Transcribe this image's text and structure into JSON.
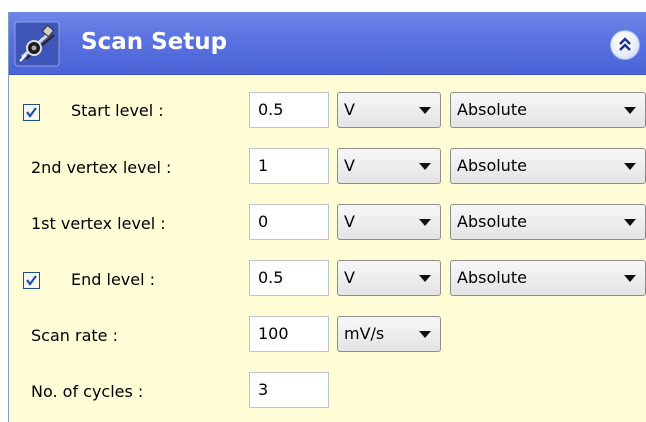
{
  "header": {
    "title": "Scan Setup",
    "icon": "scan-setup-icon",
    "collapse_icon": "double-chevron-up-icon",
    "accent": "#5a72e0"
  },
  "rows": [
    {
      "label": "Start level :",
      "has_checkbox": true,
      "checked": true,
      "value": "0.5",
      "unit": "V",
      "mode": "Absolute"
    },
    {
      "label": "2nd vertex level :",
      "has_checkbox": false,
      "value": "1",
      "unit": "V",
      "mode": "Absolute"
    },
    {
      "label": "1st vertex level :",
      "has_checkbox": false,
      "value": "0",
      "unit": "V",
      "mode": "Absolute"
    },
    {
      "label": "End level :",
      "has_checkbox": true,
      "checked": true,
      "value": "0.5",
      "unit": "V",
      "mode": "Absolute"
    },
    {
      "label": "Scan rate :",
      "has_checkbox": false,
      "value": "100",
      "unit": "mV/s"
    },
    {
      "label": "No. of cycles :",
      "has_checkbox": false,
      "value": "3"
    }
  ]
}
